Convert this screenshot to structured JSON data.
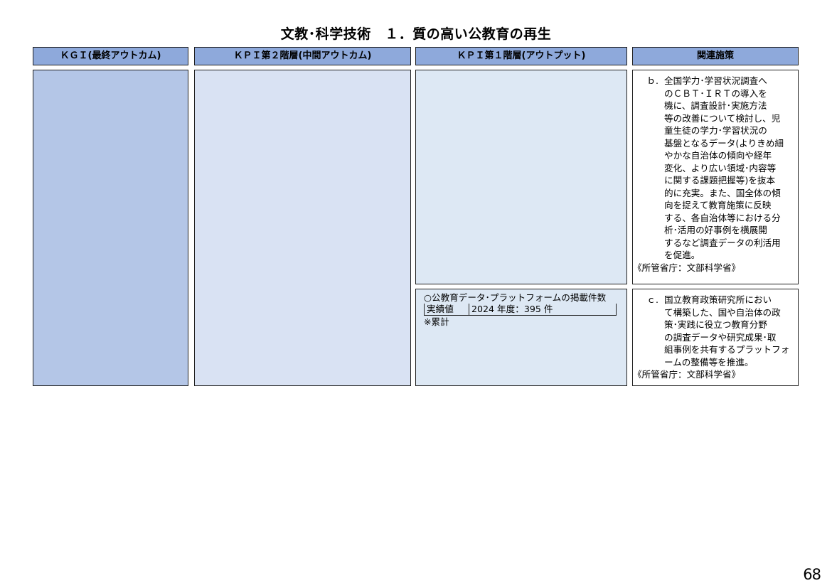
{
  "title": "文教･科学技術　１．質の高い公教育の再生",
  "headers": {
    "kgi": "ＫＧＩ(最終アウトカム)",
    "kpi2": "ＫＰＩ第２階層(中間アウトカム)",
    "kpi1": "ＫＰＩ第１階層(アウトプット)",
    "measures": "関連施策"
  },
  "kpi1_indicator": {
    "title": "○公教育データ･プラットフォームの掲載件数",
    "row_label": "実績値",
    "row_value": "2024 年度：395 件",
    "note": "※累計"
  },
  "measures": [
    {
      "letter": "ｂ.",
      "lines": [
        "全国学力･学習状況調査へ",
        "のＣＢＴ･ＩＲＴの導入を",
        "機に、調査設計･実施方法",
        "等の改善について検討し、児",
        "童生徒の学力･学習状況の",
        "基盤となるデータ(よりきめ細",
        "やかな自治体の傾向や経年",
        "変化、より広い領域･内容等",
        "に関する課題把握等)を抜本",
        "的に充実。また、国全体の傾",
        "向を捉えて教育施策に反映",
        "する、各自治体等における分",
        "析･活用の好事例を横展開",
        "するなど調査データの利活用",
        "を促進。"
      ],
      "ministry": "《所管省庁：文部科学省》"
    },
    {
      "letter": "ｃ.",
      "lines": [
        "国立教育政策研究所におい",
        "て構築した、国や自治体の政",
        "策･実践に役立つ教育分野",
        "の調査データや研究成果･取",
        "組事例を共有するプラットフォ",
        "ームの整備等を推進。"
      ],
      "ministry": "《所管省庁：文部科学省》"
    }
  ],
  "page_number": "68"
}
